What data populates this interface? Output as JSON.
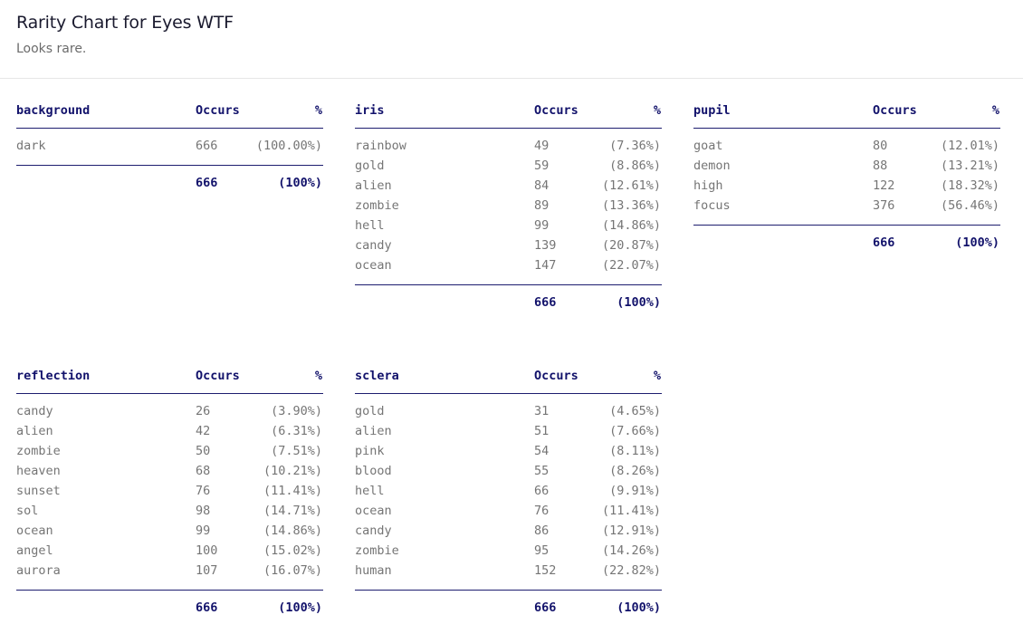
{
  "header": {
    "title": "Rarity Chart for Eyes WTF",
    "subtitle": "Looks rare."
  },
  "tables": [
    {
      "trait": "background",
      "occurs_label": "Occurs",
      "pct_label": "%",
      "rows": [
        {
          "name": "dark",
          "count": "666",
          "pct": "(100.00%)"
        }
      ],
      "total": "666",
      "total_pct": "(100%)"
    },
    {
      "trait": "iris",
      "occurs_label": "Occurs",
      "pct_label": "%",
      "rows": [
        {
          "name": "rainbow",
          "count": "49",
          "pct": "(7.36%)"
        },
        {
          "name": "gold",
          "count": "59",
          "pct": "(8.86%)"
        },
        {
          "name": "alien",
          "count": "84",
          "pct": "(12.61%)"
        },
        {
          "name": "zombie",
          "count": "89",
          "pct": "(13.36%)"
        },
        {
          "name": "hell",
          "count": "99",
          "pct": "(14.86%)"
        },
        {
          "name": "candy",
          "count": "139",
          "pct": "(20.87%)"
        },
        {
          "name": "ocean",
          "count": "147",
          "pct": "(22.07%)"
        }
      ],
      "total": "666",
      "total_pct": "(100%)"
    },
    {
      "trait": "pupil",
      "occurs_label": "Occurs",
      "pct_label": "%",
      "rows": [
        {
          "name": "goat",
          "count": "80",
          "pct": "(12.01%)"
        },
        {
          "name": "demon",
          "count": "88",
          "pct": "(13.21%)"
        },
        {
          "name": "high",
          "count": "122",
          "pct": "(18.32%)"
        },
        {
          "name": "focus",
          "count": "376",
          "pct": "(56.46%)"
        }
      ],
      "total": "666",
      "total_pct": "(100%)"
    },
    {
      "trait": "reflection",
      "occurs_label": "Occurs",
      "pct_label": "%",
      "rows": [
        {
          "name": "candy",
          "count": "26",
          "pct": "(3.90%)"
        },
        {
          "name": "alien",
          "count": "42",
          "pct": "(6.31%)"
        },
        {
          "name": "zombie",
          "count": "50",
          "pct": "(7.51%)"
        },
        {
          "name": "heaven",
          "count": "68",
          "pct": "(10.21%)"
        },
        {
          "name": "sunset",
          "count": "76",
          "pct": "(11.41%)"
        },
        {
          "name": "sol",
          "count": "98",
          "pct": "(14.71%)"
        },
        {
          "name": "ocean",
          "count": "99",
          "pct": "(14.86%)"
        },
        {
          "name": "angel",
          "count": "100",
          "pct": "(15.02%)"
        },
        {
          "name": "aurora",
          "count": "107",
          "pct": "(16.07%)"
        }
      ],
      "total": "666",
      "total_pct": "(100%)"
    },
    {
      "trait": "sclera",
      "occurs_label": "Occurs",
      "pct_label": "%",
      "rows": [
        {
          "name": "gold",
          "count": "31",
          "pct": "(4.65%)"
        },
        {
          "name": "alien",
          "count": "51",
          "pct": "(7.66%)"
        },
        {
          "name": "pink",
          "count": "54",
          "pct": "(8.11%)"
        },
        {
          "name": "blood",
          "count": "55",
          "pct": "(8.26%)"
        },
        {
          "name": "hell",
          "count": "66",
          "pct": "(9.91%)"
        },
        {
          "name": "ocean",
          "count": "76",
          "pct": "(11.41%)"
        },
        {
          "name": "candy",
          "count": "86",
          "pct": "(12.91%)"
        },
        {
          "name": "zombie",
          "count": "95",
          "pct": "(14.26%)"
        },
        {
          "name": "human",
          "count": "152",
          "pct": "(22.82%)"
        }
      ],
      "total": "666",
      "total_pct": "(100%)"
    }
  ]
}
